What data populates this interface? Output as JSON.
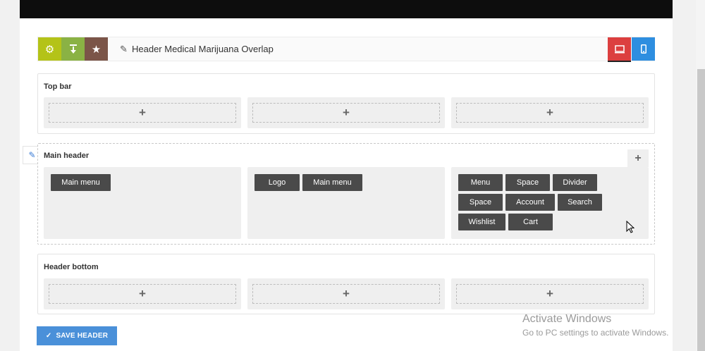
{
  "toolbar": {
    "icons": [
      "gear-icon",
      "download-icon",
      "star-icon"
    ],
    "edit_icon": "pencil-icon",
    "title": "Header Medical Marijuana Overlap",
    "devices": [
      "desktop-icon",
      "mobile-icon"
    ],
    "colors": {
      "gear": "#b4c318",
      "download": "#8ab244",
      "star": "#7b5548",
      "desktop": "#dc3f3f",
      "mobile": "#2e8ee0"
    }
  },
  "sections": {
    "top_bar": {
      "label": "Top bar"
    },
    "main_header": {
      "label": "Main header",
      "left": [
        "Main menu"
      ],
      "center": [
        "Logo",
        "Main menu"
      ],
      "right": [
        "Menu",
        "Space",
        "Divider",
        "Space",
        "Account",
        "Search",
        "Wishlist",
        "Cart"
      ]
    },
    "header_bottom": {
      "label": "Header bottom"
    }
  },
  "add_symbol": "+",
  "save": {
    "label": "SAVE HEADER",
    "icon": "check-icon"
  },
  "watermark": {
    "title": "Activate Windows",
    "subtitle": "Go to PC settings to activate Windows."
  }
}
